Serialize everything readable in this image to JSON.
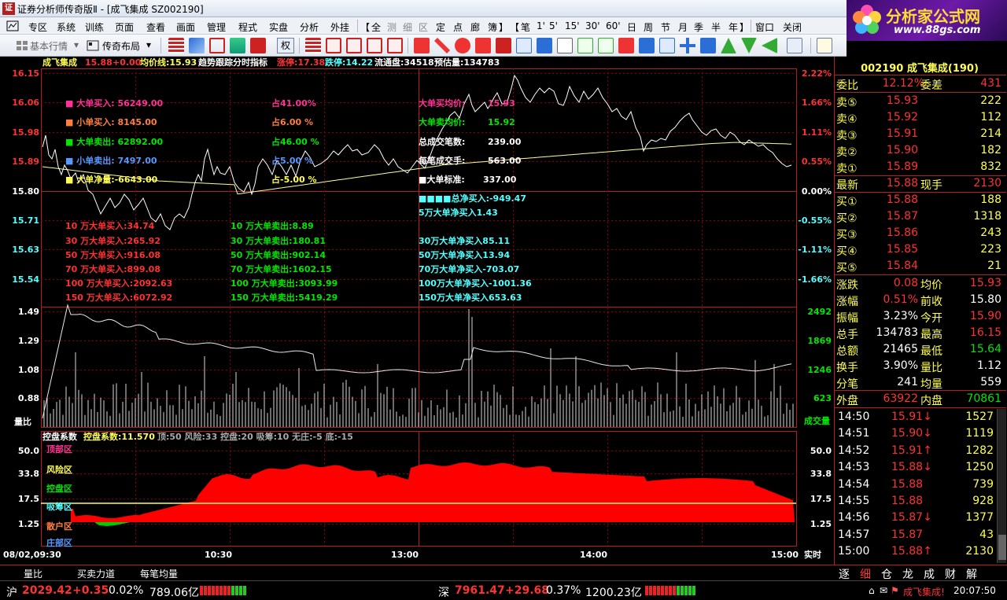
{
  "window": {
    "title": "证券分析师传奇版Ⅱ - [成飞集成 SZ002190]"
  },
  "logo": {
    "text": "分析家公式网",
    "url": "www.88gs.com"
  },
  "menu": {
    "items": [
      "专区",
      "系统",
      "训练",
      "页面",
      "查看",
      "画面",
      "管理",
      "程式",
      "实盘",
      "分析",
      "外挂"
    ],
    "period_group": [
      "全",
      "测",
      "细",
      "区",
      "定",
      "点",
      "廊",
      "簿"
    ],
    "kline_group": [
      "笔",
      "1'",
      "5'",
      "15'",
      "30'",
      "60'",
      "日",
      "周",
      "节",
      "月",
      "季",
      "半",
      "年"
    ],
    "right_items": [
      "窗口",
      "关闭"
    ]
  },
  "toolbar": {
    "basic_label": "基本行情",
    "layout_label": "传奇布局",
    "quan_label": "权"
  },
  "info_line": {
    "name": "成飞集成",
    "price": "15.88",
    "change": "+0.00",
    "avg_label": "均价线:15.93",
    "indicator": "趋势跟踪分时指标",
    "limit_up": "涨停:17.38",
    "limit_down": "跌停:14.22",
    "float": "流通盘:34518",
    "est_vol": "预估量:134783"
  },
  "price_axis_left": [
    "16.15",
    "16.06",
    "15.98",
    "15.89",
    "15.80",
    "15.71",
    "15.63",
    "15.54"
  ],
  "price_axis_right": [
    "2.22%",
    "1.66%",
    "1.11%",
    "0.55%",
    "0.00%",
    "-0.55%",
    "-1.11%",
    "-1.66%"
  ],
  "volratio_axis_left": [
    "1.49",
    "1.29",
    "1.08",
    "0.88"
  ],
  "volratio_label": "量比",
  "volume_axis_right": [
    "2492",
    "1869",
    "1246",
    "623"
  ],
  "volume_label": "成交量",
  "overlay": {
    "left": [
      {
        "text": "■ 大单买入: 56249.00",
        "color": "#ff3296"
      },
      {
        "text": "■ 小单买入: 8145.00",
        "color": "#ff7f3f"
      },
      {
        "text": "■ 大单卖出: 62892.00",
        "color": "#00e600"
      },
      {
        "text": "■ 小单卖出: 7497.00",
        "color": "#5599ff"
      },
      {
        "text": "■ 大单净量:-6643.00",
        "color": "#ffff55"
      }
    ],
    "middle": [
      {
        "text": "占41.00%",
        "color": "#ff3296"
      },
      {
        "text": "占6.00 %",
        "color": "#ff7f3f"
      },
      {
        "text": "占46.00 %",
        "color": "#00e600"
      },
      {
        "text": "占5.00 %",
        "color": "#5599ff"
      },
      {
        "text": "占-5.00 %",
        "color": "#ffff55"
      }
    ],
    "right": [
      {
        "label": "大单买均价:",
        "value": "15.93",
        "color": "#ff3296"
      },
      {
        "label": "大单卖均价:",
        "value": "15.92",
        "color": "#00e600"
      },
      {
        "label": "总成交笔数:",
        "value": "239.00",
        "color": "#ffffff"
      },
      {
        "label": "每笔成交手:",
        "value": "563.00",
        "color": "#ffffff"
      },
      {
        "label": "■大单标准:",
        "value": "337.00",
        "color": "#ffffff"
      }
    ],
    "net_total": "■■■■总净买入:-949.47",
    "net_5w": "5万大单净买入1.43",
    "col1": [
      "10 万大单买入:34.74",
      "30 万大单买入:265.92",
      "50 万大单买入:916.08",
      "70 万大单买入:899.08",
      "100 万大单买入:2092.63",
      "150 万大单买入:6072.92"
    ],
    "col2": [
      "10 万大单卖出:8.89",
      "30 万大单卖出:180.81",
      "50 万大单卖出:902.14",
      "70 万大单卖出:1602.15",
      "100 万大单卖出:3093.99",
      "150 万大单卖出:5419.29"
    ],
    "col3": [
      "30万大单净买入85.11",
      "50万大单净买入13.94",
      "70万大单净买入-703.07",
      "100万大单净买入-1001.36",
      "150万大单净买入653.63"
    ]
  },
  "indicator_panel": {
    "title": "控盘系数",
    "value_label": "控盘系数:11.570",
    "params": "顶:50 风险:33 控盘:20 吸筹:10 无庄:-5 底:-15",
    "axis": [
      "50.0",
      "33.8",
      "17.5",
      "1.25"
    ],
    "zones": [
      {
        "text": "顶部区",
        "color": "#ff3296"
      },
      {
        "text": "风险区",
        "color": "#ffff55"
      },
      {
        "text": "控盘区",
        "color": "#00e600"
      },
      {
        "text": "吸筹区",
        "color": "#55ffff"
      },
      {
        "text": "散户区",
        "color": "#ff7f3f"
      },
      {
        "text": "庄部区",
        "color": "#5599ff"
      }
    ]
  },
  "time_axis": {
    "labels": [
      "08/02,09:30",
      "10:30",
      "13:00",
      "14:00",
      "15:00"
    ],
    "realtime": "实时"
  },
  "bottom_tabs": [
    "量比",
    "买卖力道",
    "每笔均量"
  ],
  "right_panel": {
    "header": "002190 成飞集成(190)",
    "webi": {
      "label": "委比",
      "value": "12.12%",
      "label2": "委差",
      "value2": "431"
    },
    "sell": [
      {
        "label": "卖⑤",
        "price": "15.93",
        "vol": "222"
      },
      {
        "label": "卖④",
        "price": "15.92",
        "vol": "112"
      },
      {
        "label": "卖③",
        "price": "15.91",
        "vol": "214"
      },
      {
        "label": "卖②",
        "price": "15.90",
        "vol": "182"
      },
      {
        "label": "卖①",
        "price": "15.89",
        "vol": "832"
      }
    ],
    "latest": {
      "label": "最新",
      "value": "15.88",
      "label2": "现手",
      "value2": "2130"
    },
    "buy": [
      {
        "label": "买①",
        "price": "15.88",
        "vol": "188"
      },
      {
        "label": "买②",
        "price": "15.87",
        "vol": "1318"
      },
      {
        "label": "买③",
        "price": "15.86",
        "vol": "243"
      },
      {
        "label": "买④",
        "price": "15.85",
        "vol": "223"
      },
      {
        "label": "买⑤",
        "price": "15.84",
        "vol": "21"
      }
    ],
    "stats": [
      {
        "l1": "涨跌",
        "v1": "0.08",
        "c1": "red",
        "l2": "均价",
        "v2": "15.93",
        "c2": "red"
      },
      {
        "l1": "涨幅",
        "v1": "0.51%",
        "c1": "red",
        "l2": "前收",
        "v2": "15.80",
        "c2": "white"
      },
      {
        "l1": "振幅",
        "v1": "3.23%",
        "c1": "white",
        "l2": "今开",
        "v2": "15.90",
        "c2": "red"
      },
      {
        "l1": "总手",
        "v1": "134783",
        "c1": "white",
        "l2": "最高",
        "v2": "16.15",
        "c2": "red"
      },
      {
        "l1": "总额",
        "v1": "21465",
        "c1": "white",
        "l2": "最低",
        "v2": "15.64",
        "c2": "green"
      },
      {
        "l1": "换手",
        "v1": "3.90%",
        "c1": "white",
        "l2": "量比",
        "v2": "1.12",
        "c2": "white"
      },
      {
        "l1": "分笔",
        "v1": "241",
        "c1": "white",
        "l2": "均量",
        "v2": "559",
        "c2": "white"
      }
    ],
    "outer_inner": {
      "l1": "外盘",
      "v1": "63922",
      "l2": "内盘",
      "v2": "70861"
    },
    "ticks": [
      {
        "time": "14:50",
        "price": "15.91↓",
        "pcolor": "red",
        "vol": "1527",
        "vcolor": "green"
      },
      {
        "time": "14:51",
        "price": "15.90↓",
        "pcolor": "red",
        "vol": "1119",
        "vcolor": "green"
      },
      {
        "time": "14:52",
        "price": "15.91↑",
        "pcolor": "red",
        "vol": "1282",
        "vcolor": "red"
      },
      {
        "time": "14:53",
        "price": "15.88↓",
        "pcolor": "red",
        "vol": "1250",
        "vcolor": "green"
      },
      {
        "time": "14:54",
        "price": "15.88",
        "pcolor": "red",
        "vol": "739",
        "vcolor": "green"
      },
      {
        "time": "14:55",
        "price": "15.88",
        "pcolor": "red",
        "vol": "928",
        "vcolor": "green"
      },
      {
        "time": "14:56",
        "price": "15.87↓",
        "pcolor": "red",
        "vol": "1377",
        "vcolor": "green"
      },
      {
        "time": "14:57",
        "price": "15.87",
        "pcolor": "red",
        "vol": "43",
        "vcolor": "red"
      },
      {
        "time": "15:00",
        "price": "15.88↑",
        "pcolor": "red",
        "vol": "2130",
        "vcolor": "red"
      }
    ],
    "tabs": [
      "逐",
      "细",
      "仓",
      "龙",
      "成",
      "财",
      "解"
    ]
  },
  "status": {
    "sh_label": "沪",
    "sh_index": "2029.42",
    "sh_change": "+0.35",
    "sh_pct": "0.02%",
    "sh_amount": "789.06亿",
    "sz_label": "深",
    "sz_index": "7961.47",
    "sz_change": "+29.68",
    "sz_pct": "0.37%",
    "sz_amount": "1200.23亿",
    "stock_note": "成飞集成!",
    "clock": "20:07:50"
  },
  "colors": {
    "price_line": "#ffffff",
    "avg_line": "#ffff99",
    "indicator_fill": "#ff0000",
    "grid": "#8b0000",
    "up": "#ff3232",
    "down": "#00e600"
  }
}
